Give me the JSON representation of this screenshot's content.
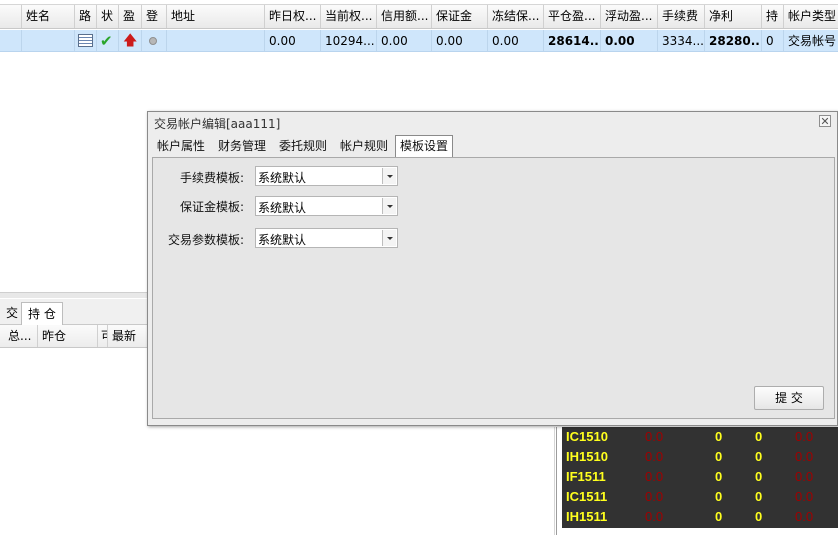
{
  "grid": {
    "headers": [
      "姓名",
      "路",
      "状",
      "盈",
      "登",
      "地址",
      "昨日权...",
      "当前权...",
      "信用额...",
      "保证金",
      "冻结保...",
      "平仓盈...",
      "浮动盈...",
      "手续费",
      "净利",
      "持",
      "帐户类型"
    ],
    "row": {
      "route_icon": "list-icon",
      "status_icon": "check-icon",
      "profit_icon": "red-up-arrow-icon",
      "login_icon": "gray-dot-icon",
      "yesterday_equity": "0.00",
      "current_equity": "10294...",
      "credit": "0.00",
      "margin": "0.00",
      "frozen_margin": "0.00",
      "close_profit": "28614...",
      "float_profit": "0.00",
      "fee": "3334...",
      "net_profit": "28280...",
      "positions": "0",
      "account_type": "交易帐号"
    }
  },
  "lower_panel": {
    "tabs": [
      "交",
      "持 仓"
    ],
    "headers": [
      "总...",
      "昨仓",
      "可",
      "最新"
    ]
  },
  "market": {
    "rows": [
      {
        "symbol": "IC1510",
        "v1": "0.0",
        "v2": "0",
        "v3": "0",
        "v4": "0.0"
      },
      {
        "symbol": "IH1510",
        "v1": "0.0",
        "v2": "0",
        "v3": "0",
        "v4": "0.0"
      },
      {
        "symbol": "IF1511",
        "v1": "0.0",
        "v2": "0",
        "v3": "0",
        "v4": "0.0"
      },
      {
        "symbol": "IC1511",
        "v1": "0.0",
        "v2": "0",
        "v3": "0",
        "v4": "0.0"
      },
      {
        "symbol": "IH1511",
        "v1": "0.0",
        "v2": "0",
        "v3": "0",
        "v4": "0.0"
      }
    ]
  },
  "dialog": {
    "title": "交易帐户编辑[aaa111]",
    "close_icon": "close-icon",
    "tabs": [
      "帐户属性",
      "财务管理",
      "委托规则",
      "帐户规则",
      "模板设置"
    ],
    "fields": [
      {
        "label": "手续费模板:",
        "value": "系统默认"
      },
      {
        "label": "保证金模板:",
        "value": "系统默认"
      },
      {
        "label": "交易参数模板:",
        "value": "系统默认"
      }
    ],
    "submit_label": "提 交"
  }
}
